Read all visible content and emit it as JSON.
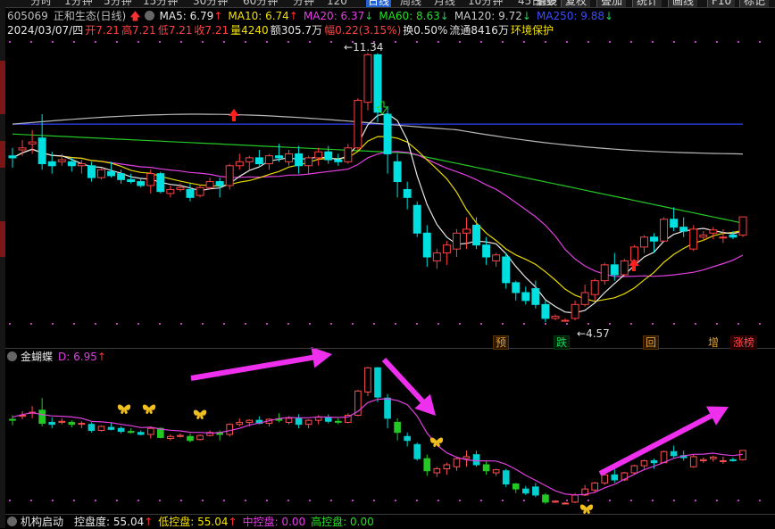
{
  "toolbar": {
    "items": [
      "分时",
      "1分钟",
      "5分钟",
      "15分钟",
      "30分钟",
      "60分钟",
      "分钟",
      "120",
      "日线",
      "周线",
      "月线",
      "10分钟",
      "45日线",
      "季线",
      "更多"
    ],
    "active_index": 8,
    "buttons": [
      "复权",
      "叠加",
      "统计",
      "画线",
      "F10",
      "标记"
    ]
  },
  "header": {
    "code": "605069",
    "name": "正和生态(日线)",
    "ma": [
      {
        "label": "MA5: 6.79",
        "arrow": "↑",
        "color": "#e8e8e8",
        "arrow_color": "#ff3030"
      },
      {
        "label": "MA10: 6.74",
        "arrow": "↑",
        "color": "#f2e000",
        "arrow_color": "#ff3030"
      },
      {
        "label": "MA20: 6.37",
        "arrow": "↓",
        "color": "#e83ce8",
        "arrow_color": "#1bd25a"
      },
      {
        "label": "MA60: 8.63",
        "arrow": "↓",
        "color": "#24e024",
        "arrow_color": "#1bd25a"
      },
      {
        "label": "MA120: 9.72",
        "arrow": "↓",
        "color": "#c8c8c8",
        "arrow_color": "#1bd25a"
      },
      {
        "label": "MA250: 9.88",
        "arrow": "↓",
        "color": "#3a4cff",
        "arrow_color": "#1bd25a"
      }
    ],
    "date": "2024/03/07/四",
    "stats": [
      {
        "text": "开7.21",
        "color": "#ff4040"
      },
      {
        "text": "高7.21",
        "color": "#ff4040"
      },
      {
        "text": "低7.21",
        "color": "#ff4040"
      },
      {
        "text": "收7.21",
        "color": "#ff4040"
      },
      {
        "text": "量4240",
        "color": "#f2e000"
      },
      {
        "text": "额305.7万",
        "color": "#e6e6e6"
      },
      {
        "text": "幅0.22(3.15%)",
        "color": "#ff4040"
      },
      {
        "text": "换0.50%",
        "color": "#e6e6e6"
      },
      {
        "text": "流通8416万",
        "color": "#e6e6e6"
      },
      {
        "text": "环境保护",
        "color": "#f2e000"
      }
    ]
  },
  "price_annotations": {
    "high": "11.34",
    "low": "4.57"
  },
  "event_tags": [
    {
      "text": "预",
      "style": "orange"
    },
    {
      "text": "跌",
      "style": "green"
    },
    {
      "text": "回",
      "style": "orange"
    },
    {
      "text": "增",
      "style": "orange"
    },
    {
      "text": "涨榜",
      "style": "red"
    }
  ],
  "indicator1": {
    "name": "金蝴蝶",
    "value": "D: 6.95",
    "arrow": "↑",
    "butterflies": 6
  },
  "indicator2": {
    "name": "机构启动",
    "items": [
      {
        "text": "控盘度: 55.04",
        "arrow": "↑",
        "color": "#e6e6e6"
      },
      {
        "text": "低控盘: 55.04",
        "arrow": "↑",
        "color": "#f2e000"
      },
      {
        "text": "中控盘: 0.00",
        "arrow": "",
        "color": "#e83ce8"
      },
      {
        "text": "高控盘: 0.00",
        "arrow": "",
        "color": "#24e024"
      }
    ]
  },
  "colors": {
    "up": "#ff4040",
    "down": "#00e0e0",
    "accent": "#e040e0"
  },
  "chart_data": {
    "type": "candlestick",
    "title": "605069 正和生态(日线)",
    "price_range": [
      4.57,
      11.34
    ],
    "ohlc": [
      [
        8.75,
        8.95,
        8.45,
        8.7
      ],
      [
        8.9,
        9.15,
        8.75,
        8.95
      ],
      [
        9.05,
        9.4,
        8.8,
        9.1
      ],
      [
        9.2,
        9.8,
        8.4,
        8.55
      ],
      [
        8.6,
        8.85,
        8.3,
        8.5
      ],
      [
        8.6,
        8.8,
        8.5,
        8.65
      ],
      [
        8.6,
        8.7,
        8.35,
        8.5
      ],
      [
        8.5,
        8.65,
        8.3,
        8.55
      ],
      [
        8.5,
        8.6,
        8.1,
        8.2
      ],
      [
        8.2,
        8.45,
        8.15,
        8.4
      ],
      [
        8.35,
        8.6,
        8.2,
        8.25
      ],
      [
        8.3,
        8.4,
        8.05,
        8.15
      ],
      [
        8.15,
        8.3,
        8.05,
        8.1
      ],
      [
        8.1,
        8.2,
        7.95,
        8.0
      ],
      [
        8.0,
        8.4,
        7.8,
        8.3
      ],
      [
        8.3,
        8.35,
        7.8,
        7.85
      ],
      [
        7.8,
        8.0,
        7.7,
        7.9
      ],
      [
        7.9,
        8.05,
        7.85,
        7.95
      ],
      [
        7.9,
        8.05,
        7.6,
        7.7
      ],
      [
        7.75,
        8.0,
        7.7,
        7.95
      ],
      [
        7.95,
        8.2,
        7.9,
        8.1
      ],
      [
        8.1,
        8.2,
        7.7,
        8.0
      ],
      [
        8.0,
        8.55,
        7.9,
        8.5
      ],
      [
        8.5,
        8.8,
        8.4,
        8.6
      ],
      [
        8.6,
        8.75,
        8.4,
        8.7
      ],
      [
        8.7,
        8.9,
        8.5,
        8.55
      ],
      [
        8.55,
        8.8,
        8.4,
        8.75
      ],
      [
        8.75,
        9.05,
        8.6,
        8.7
      ],
      [
        8.6,
        8.9,
        8.5,
        8.8
      ],
      [
        8.8,
        9.0,
        8.3,
        8.5
      ],
      [
        8.5,
        8.75,
        8.3,
        8.7
      ],
      [
        8.7,
        8.95,
        8.5,
        8.85
      ],
      [
        8.85,
        9.0,
        8.55,
        8.65
      ],
      [
        8.65,
        8.8,
        8.5,
        8.6
      ],
      [
        8.6,
        9.05,
        8.55,
        8.95
      ],
      [
        8.95,
        10.2,
        8.9,
        10.15
      ],
      [
        10.1,
        11.34,
        9.9,
        11.3
      ],
      [
        11.3,
        11.34,
        9.6,
        9.85
      ],
      [
        9.8,
        10.0,
        8.3,
        8.8
      ],
      [
        8.6,
        8.8,
        7.7,
        8.1
      ],
      [
        7.9,
        8.1,
        7.4,
        7.7
      ],
      [
        7.5,
        7.6,
        6.7,
        6.8
      ],
      [
        6.8,
        7.0,
        5.95,
        6.2
      ],
      [
        6.1,
        6.4,
        5.9,
        6.3
      ],
      [
        6.3,
        6.6,
        6.0,
        6.5
      ],
      [
        6.4,
        6.9,
        6.2,
        6.8
      ],
      [
        6.8,
        7.2,
        6.4,
        6.9
      ],
      [
        7.0,
        7.2,
        6.4,
        6.5
      ],
      [
        6.5,
        6.7,
        6.0,
        6.2
      ],
      [
        6.1,
        6.3,
        5.95,
        6.25
      ],
      [
        6.2,
        6.3,
        5.4,
        5.55
      ],
      [
        5.55,
        5.6,
        5.1,
        5.3
      ],
      [
        5.3,
        5.45,
        5.0,
        5.1
      ],
      [
        5.4,
        5.6,
        4.9,
        5.0
      ],
      [
        5.0,
        5.1,
        4.55,
        4.65
      ],
      [
        4.65,
        4.75,
        4.6,
        4.7
      ],
      [
        4.6,
        4.65,
        4.57,
        4.6
      ],
      [
        4.65,
        5.1,
        4.6,
        5.0
      ],
      [
        5.0,
        5.5,
        4.95,
        5.3
      ],
      [
        5.25,
        5.65,
        5.1,
        5.6
      ],
      [
        5.6,
        6.05,
        5.5,
        6.0
      ],
      [
        6.0,
        6.3,
        5.6,
        5.75
      ],
      [
        5.75,
        6.15,
        5.7,
        6.1
      ],
      [
        6.1,
        6.5,
        6.0,
        6.45
      ],
      [
        6.45,
        6.75,
        6.3,
        6.7
      ],
      [
        6.7,
        6.8,
        6.3,
        6.6
      ],
      [
        6.6,
        7.2,
        6.6,
        7.15
      ],
      [
        7.15,
        7.45,
        6.85,
        6.95
      ],
      [
        6.95,
        7.2,
        6.7,
        6.85
      ],
      [
        6.4,
        7.0,
        6.35,
        6.9
      ],
      [
        6.7,
        6.85,
        6.6,
        6.75
      ],
      [
        6.8,
        6.95,
        6.65,
        6.88
      ],
      [
        6.7,
        6.9,
        6.55,
        6.7
      ],
      [
        6.75,
        6.85,
        6.65,
        6.7
      ],
      [
        6.75,
        7.21,
        6.7,
        7.21
      ]
    ],
    "ma_labels": [
      "MA5",
      "MA10",
      "MA20",
      "MA60",
      "MA120",
      "MA250"
    ]
  }
}
